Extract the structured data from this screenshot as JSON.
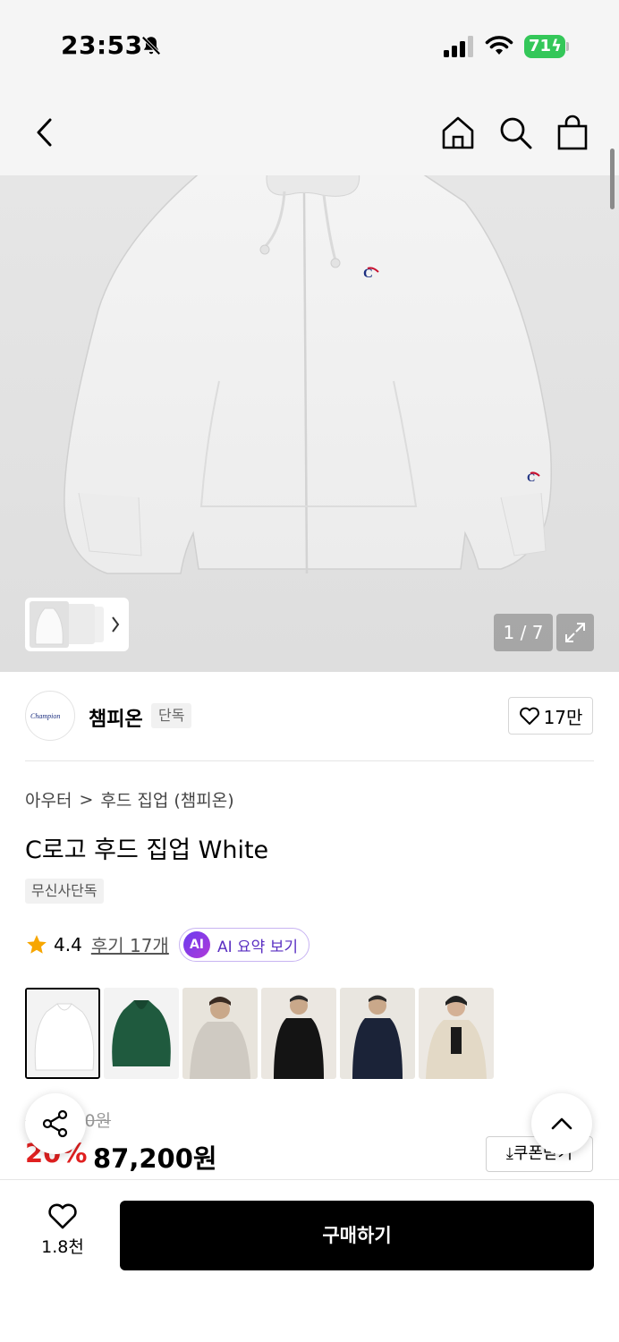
{
  "status_bar": {
    "time": "23:53",
    "battery": "71"
  },
  "header": {
    "back_icon": "chevron-left-icon",
    "home_icon": "home-icon",
    "search_icon": "search-icon",
    "cart_icon": "shopping-bag-icon"
  },
  "gallery": {
    "counter": "1 / 7",
    "expand_icon": "expand-icon"
  },
  "brand": {
    "name": "챔피온",
    "badge": "단독",
    "logo_text": "Champion",
    "like_count": "17만"
  },
  "breadcrumb": {
    "category": "아우터",
    "separator": ">",
    "subcategory": "후드 집업 (챔피온)"
  },
  "product": {
    "title": "C로고 후드 집업 White",
    "exclusive_label": "무신사단독",
    "rating": "4.4",
    "review_link": "후기 17개",
    "ai_badge": "AI",
    "ai_summary": "AI 요약 보기"
  },
  "price": {
    "original": "109,000원",
    "discount": "20%",
    "sale": "87,200원",
    "coupon_button": "쿠폰받기"
  },
  "bottom_bar": {
    "wish_count": "1.8천",
    "buy_button": "구매하기"
  },
  "colors": {
    "accent": "#000000",
    "discount": "#e02020",
    "ai": "#5a2fc2",
    "battery": "#34c759"
  }
}
